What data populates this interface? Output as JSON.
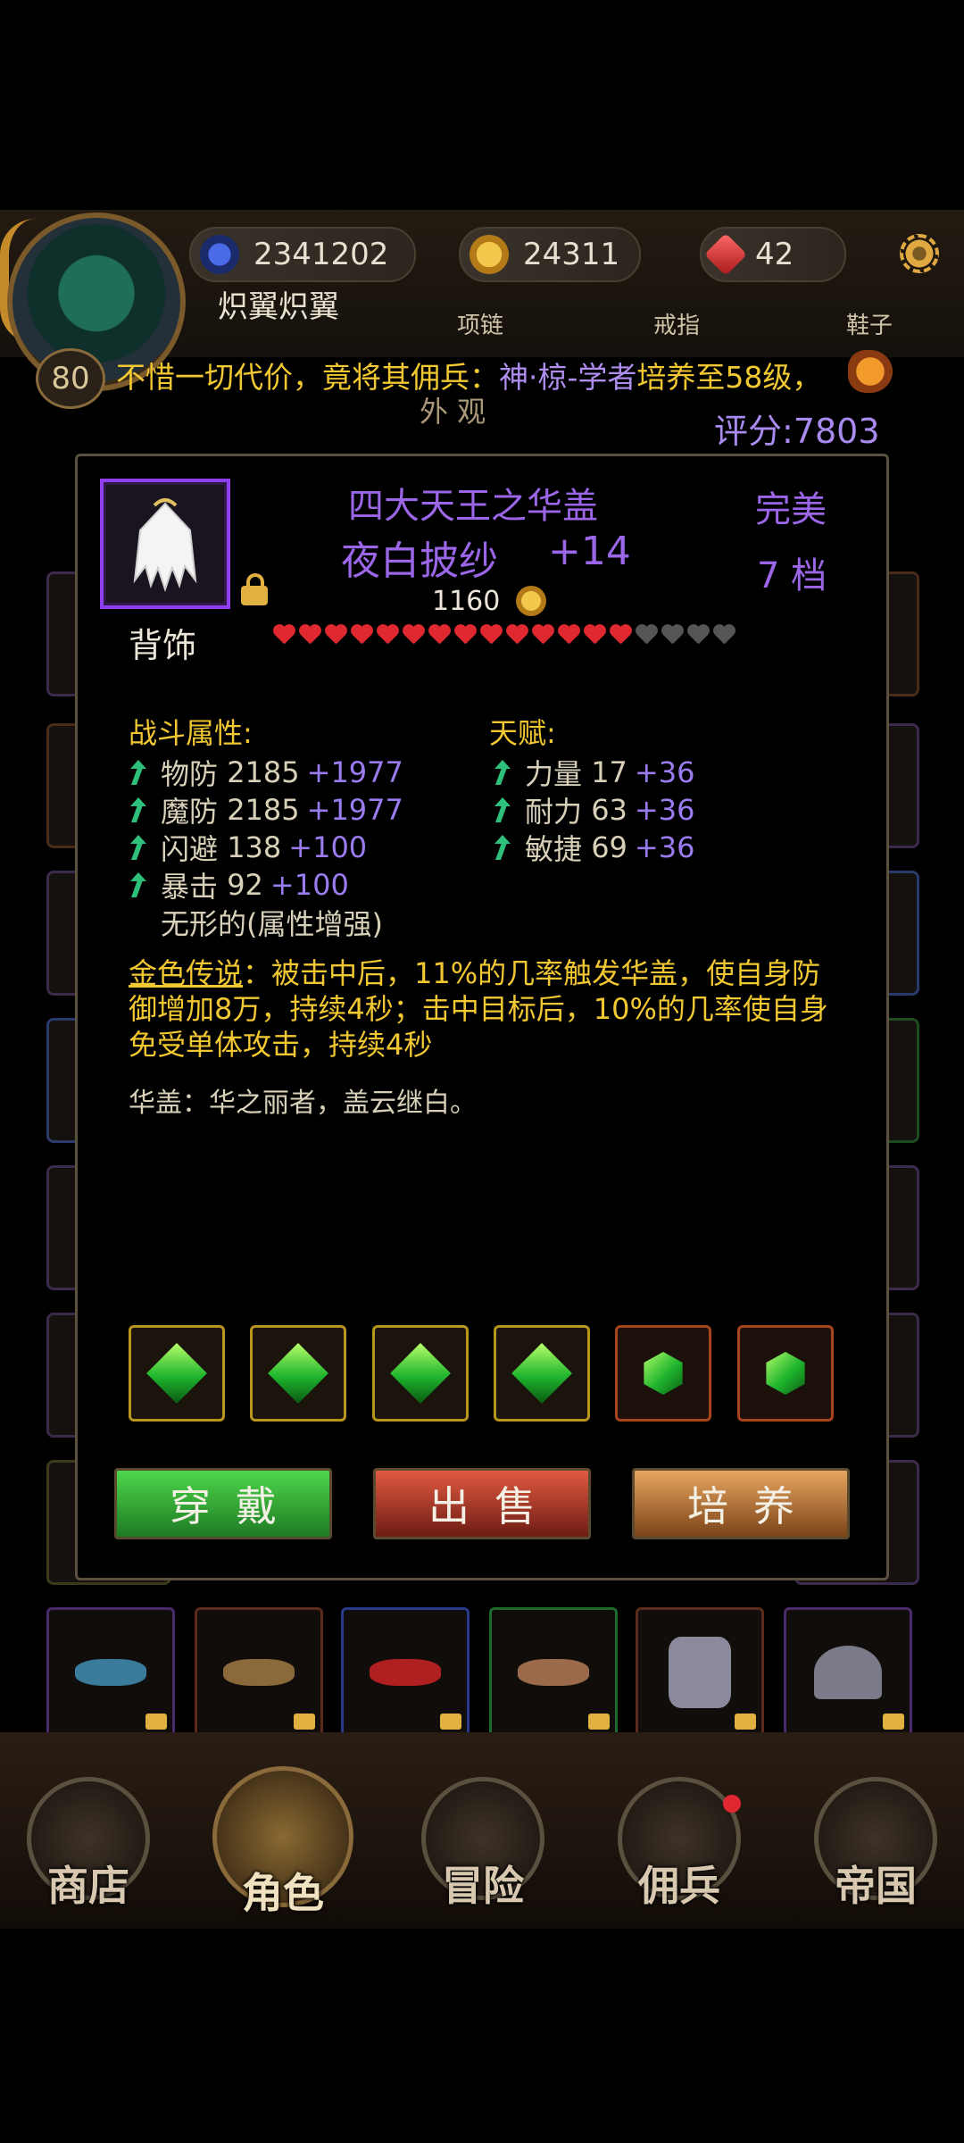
{
  "hud": {
    "player_name": "炽翼炽翼",
    "level": "80",
    "resources": [
      {
        "icon": "sapphire-gem-icon",
        "value": "2341202"
      },
      {
        "icon": "gold-coin-icon",
        "value": "24311"
      },
      {
        "icon": "ruby-gem-icon",
        "value": "42"
      }
    ],
    "slot_labels": [
      "项链",
      "戒指",
      "鞋子"
    ],
    "settings_icon": "gear-icon"
  },
  "marquee": {
    "prefix": "不惜一切代价，竟将其佣兵：",
    "highlight": "神·椋-学者",
    "suffix": "培养至58级，"
  },
  "header": {
    "tab": "外 观",
    "score": "评分:7803"
  },
  "item": {
    "series": "四大天王之华盖",
    "name": "夜白披纱",
    "enhance": "+14",
    "price": "1160",
    "quality": "完美",
    "grade": "7 档",
    "category": "背饰",
    "hearts_filled": 14,
    "hearts_total": 18,
    "icon": "white-feather-cape-icon"
  },
  "combat": {
    "title": "战斗属性:",
    "attrs": [
      {
        "name": "物防",
        "base": "2185",
        "bonus": "+1977"
      },
      {
        "name": "魔防",
        "base": "2185",
        "bonus": "+1977"
      },
      {
        "name": "闪避",
        "base": "138",
        "bonus": "+100"
      },
      {
        "name": "暴击",
        "base": "92",
        "bonus": "+100"
      }
    ],
    "affix": "无形的(属性增强)"
  },
  "talent": {
    "title": "天赋:",
    "attrs": [
      {
        "name": "力量",
        "base": "17",
        "bonus": "+36"
      },
      {
        "name": "耐力",
        "base": "63",
        "bonus": "+36"
      },
      {
        "name": "敏捷",
        "base": "69",
        "bonus": "+36"
      }
    ]
  },
  "legend": {
    "label": "金色传说",
    "text": "：被击中后，11%的几率触发华盖，使自身防御增加8万，持续4秒；击中目标后，10%的几率使自身免受单体攻击，持续4秒"
  },
  "flavor": "华盖：华之丽者，盖云继白。",
  "gems": [
    {
      "type": "gold",
      "icon": "green-diamond-gem-icon"
    },
    {
      "type": "gold",
      "icon": "green-diamond-gem-icon"
    },
    {
      "type": "gold",
      "icon": "green-diamond-gem-icon"
    },
    {
      "type": "gold",
      "icon": "green-diamond-gem-icon"
    },
    {
      "type": "orange",
      "icon": "green-hex-gem-icon"
    },
    {
      "type": "orange",
      "icon": "green-hex-gem-icon"
    }
  ],
  "buttons": {
    "equip": "穿戴",
    "sell": "出售",
    "train": "培养"
  },
  "nav": [
    {
      "label": "商店",
      "icon": "shop-icon"
    },
    {
      "label": "角色",
      "icon": "hooded-hero-icon"
    },
    {
      "label": "冒险",
      "icon": "crossed-swords-icon"
    },
    {
      "label": "佣兵",
      "icon": "mercenary-cards-icon"
    },
    {
      "label": "帝国",
      "icon": "crown-icon"
    }
  ],
  "colors": {
    "epic": "#9b66e8",
    "gold": "#f2c832",
    "bonus": "#9b7cf0",
    "up_arrow": "#2ec07a"
  }
}
